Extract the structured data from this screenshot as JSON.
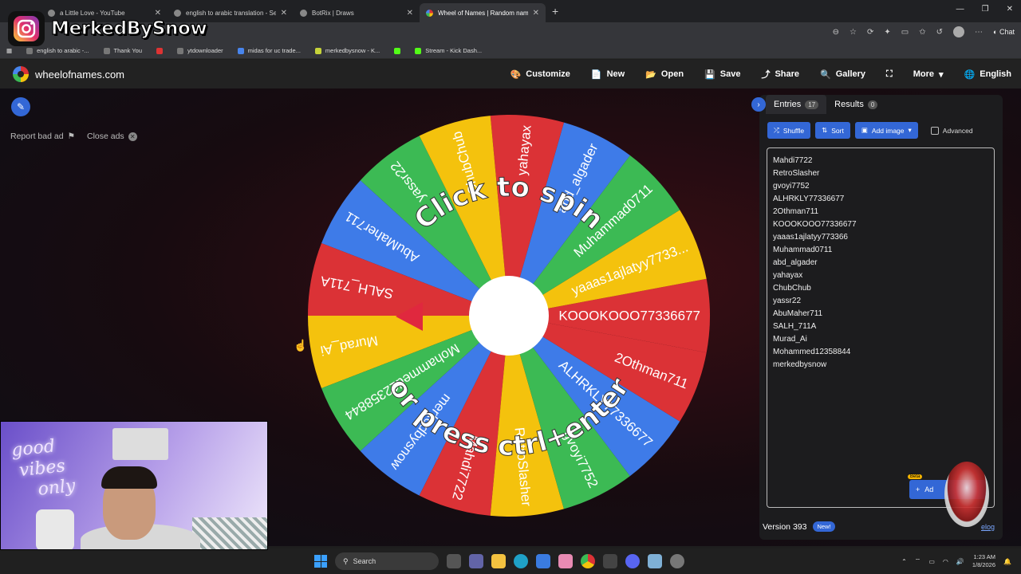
{
  "overlay": {
    "instagram_handle": "MerkedBySnow"
  },
  "browser": {
    "tabs": [
      {
        "title": "a Little Love - YouTube",
        "active": false
      },
      {
        "title": "english to arabic translation - Sear",
        "active": false
      },
      {
        "title": "BotRix | Draws",
        "active": false
      },
      {
        "title": "Wheel of Names | Random name",
        "active": true
      }
    ],
    "chat_label": "Chat",
    "bookmarks": [
      "english to arabic -...",
      "Thank You",
      "ytdownloader",
      "midas for uc trade...",
      "merkedbysnow - K...",
      "Stream - Kick Dash..."
    ]
  },
  "site": {
    "brand": "wheelofnames.com",
    "nav": [
      {
        "label": "Customize",
        "icon": "palette-icon",
        "glyph": "🎨"
      },
      {
        "label": "New",
        "icon": "new-file-icon",
        "glyph": "📄"
      },
      {
        "label": "Open",
        "icon": "folder-icon",
        "glyph": "📂"
      },
      {
        "label": "Save",
        "icon": "save-icon",
        "glyph": "💾"
      },
      {
        "label": "Share",
        "icon": "share-icon",
        "glyph": "⤴"
      },
      {
        "label": "Gallery",
        "icon": "search-icon",
        "glyph": "🔍"
      },
      {
        "label": "",
        "icon": "fullscreen-icon",
        "glyph": "⛶"
      },
      {
        "label": "More",
        "icon": "chevron-down-icon",
        "glyph": "▾"
      },
      {
        "label": "English",
        "icon": "globe-icon",
        "glyph": "🌐"
      }
    ],
    "report_ad": "Report bad ad",
    "close_ads": "Close ads"
  },
  "wheel": {
    "prompt_top": "Click to spin",
    "prompt_bottom": "or press ctrl+enter",
    "colors": [
      "#db3236",
      "#3e7be8",
      "#3cba54",
      "#f4c20d"
    ],
    "slices": [
      "KOOOKOOO77336677",
      "yaaas1ajlatyy7733...",
      "Muhammad0711",
      "abd_algader",
      "yahayax",
      "ChubChub",
      "yassr22",
      "AbuMaher711",
      "SALH_711A",
      "Murad_Ai",
      "Mohammed12358844",
      "merkedbysnow",
      "Mahdi7722",
      "RetroSlasher",
      "gvoyi7752",
      "ALHRKLY77336677",
      "2Othman711"
    ]
  },
  "panel": {
    "entries_tab": "Entries",
    "entries_count": "17",
    "results_tab": "Results",
    "results_count": "0",
    "shuffle": "Shuffle",
    "sort": "Sort",
    "add_image": "Add image",
    "advanced": "Advanced",
    "entries": [
      "Mahdi7722",
      "RetroSlasher",
      "gvoyi7752",
      "ALHRKLY77336677",
      "2Othman711",
      "KOOOKOOO77336677",
      "yaaas1ajlatyy773366",
      "Muhammad0711",
      "abd_algader",
      "yahayax",
      "ChubChub",
      "yassr22",
      "AbuMaher711",
      "SALH_711A",
      "Murad_Ai",
      "Mohammed12358844",
      "merkedbysnow"
    ],
    "beta": "Beta",
    "add_label": "Ad",
    "version": "Version 393",
    "new_badge": "New!",
    "changelog": "elog"
  },
  "taskbar": {
    "search": "Search",
    "time": "1:23 AM",
    "date": "1/8/2026"
  }
}
